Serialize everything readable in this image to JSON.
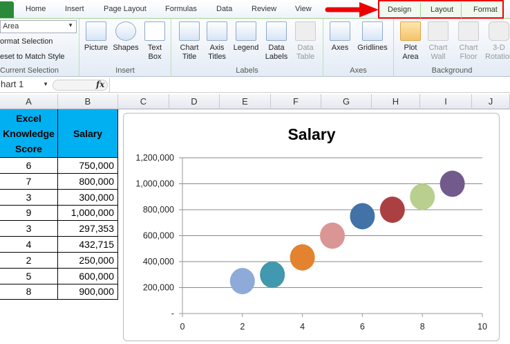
{
  "ribbon_tabs": [
    "Home",
    "Insert",
    "Page Layout",
    "Formulas",
    "Data",
    "Review",
    "View"
  ],
  "context_tabs": [
    "Design",
    "Layout",
    "Format"
  ],
  "current_selection": {
    "dropdown": "Area",
    "format_selection": "ormat Selection",
    "reset": "eset to Match Style",
    "label": "Current Selection"
  },
  "groups": {
    "insert": {
      "label": "Insert",
      "buttons": [
        "Picture",
        "Shapes",
        "Text Box"
      ]
    },
    "labels": {
      "label": "Labels",
      "buttons": [
        "Chart Title",
        "Axis Titles",
        "Legend",
        "Data Labels",
        "Data Table"
      ]
    },
    "axes": {
      "label": "Axes",
      "buttons": [
        "Axes",
        "Gridlines"
      ]
    },
    "background": {
      "label": "Background",
      "buttons": [
        "Plot Area",
        "Chart Wall",
        "Chart Floor",
        "3-D Rotation"
      ]
    }
  },
  "name_box": "hart 1",
  "fx": "fx",
  "columns": [
    "A",
    "B",
    "C",
    "D",
    "E",
    "F",
    "G",
    "H",
    "I",
    "J"
  ],
  "table": {
    "headers": [
      "Excel Knowledge Score",
      "Salary"
    ],
    "rows": [
      [
        "6",
        "750,000"
      ],
      [
        "7",
        "800,000"
      ],
      [
        "3",
        "300,000"
      ],
      [
        "9",
        "1,000,000"
      ],
      [
        "3",
        "297,353"
      ],
      [
        "4",
        "432,715"
      ],
      [
        "2",
        "250,000"
      ],
      [
        "5",
        "600,000"
      ],
      [
        "8",
        "900,000"
      ]
    ]
  },
  "chart_data": {
    "type": "scatter",
    "subtype": "bubble",
    "title": "Salary",
    "xlim": [
      0,
      10
    ],
    "ylim": [
      0,
      1200000
    ],
    "x_ticks": [
      "0",
      "2",
      "4",
      "6",
      "8",
      "10"
    ],
    "y_ticks": [
      "-",
      "200,000",
      "400,000",
      "600,000",
      "800,000",
      "1,000,000",
      "1,200,000"
    ],
    "grid": "horizontal",
    "points": [
      {
        "x": 2,
        "y": 250000,
        "color": "#8eaad8"
      },
      {
        "x": 3,
        "y": 297353,
        "color": "#9bbb59"
      },
      {
        "x": 3,
        "y": 300000,
        "color": "#4198af"
      },
      {
        "x": 4,
        "y": 432715,
        "color": "#e3832f"
      },
      {
        "x": 5,
        "y": 600000,
        "color": "#d99694"
      },
      {
        "x": 6,
        "y": 750000,
        "color": "#4172a8"
      },
      {
        "x": 7,
        "y": 800000,
        "color": "#ab4043"
      },
      {
        "x": 8,
        "y": 900000,
        "color": "#b8cf8d"
      },
      {
        "x": 9,
        "y": 1000000,
        "color": "#725a8c"
      }
    ]
  }
}
